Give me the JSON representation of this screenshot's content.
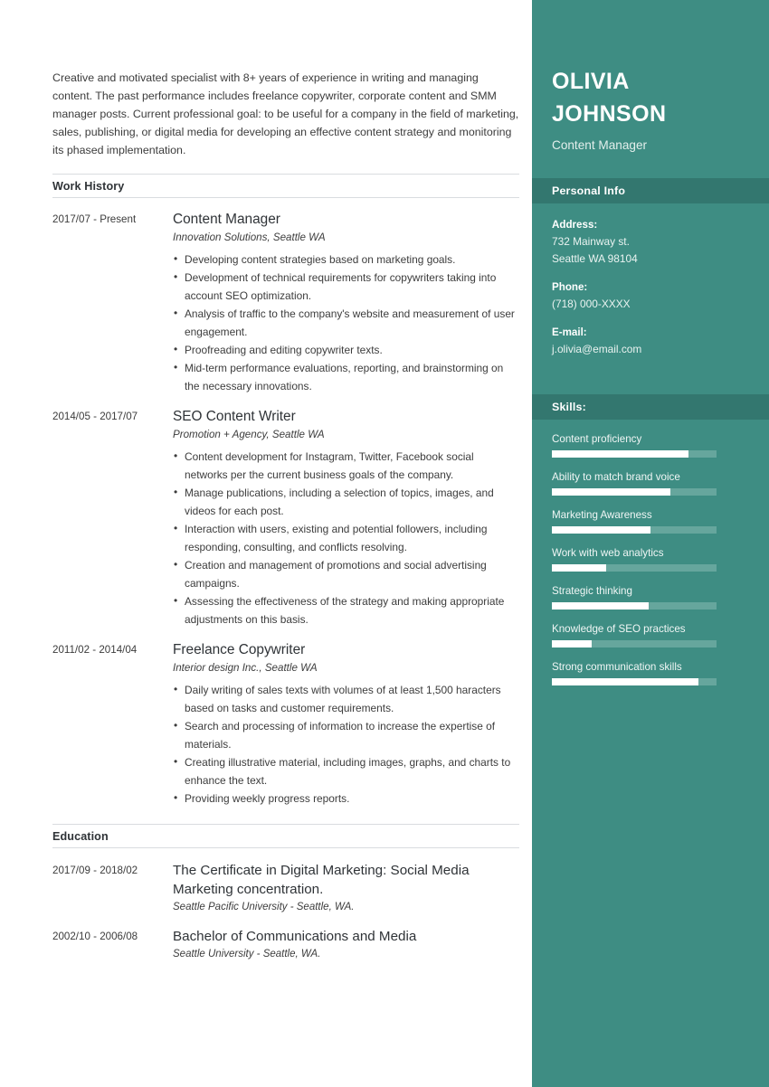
{
  "summary": "Creative and motivated specialist with 8+ years of experience in writing and managing content. The past performance includes freelance copywriter, corporate content and SMM manager posts. Current professional goal: to be useful for a company in the field of marketing, sales, publishing, or digital media for developing an effective content strategy and monitoring its phased implementation.",
  "sections": {
    "work_history_title": "Work History",
    "education_title": "Education"
  },
  "work_history": [
    {
      "date": "2017/07 - Present",
      "title": "Content Manager",
      "org": "Innovation Solutions, Seattle WA",
      "bullets": [
        "Developing content strategies based on marketing goals.",
        "Development of technical requirements for copywriters taking into account SEO optimization.",
        "Analysis of traffic to the company's website and measurement of user engagement.",
        "Proofreading and editing copywriter texts.",
        "Mid-term performance evaluations, reporting, and brainstorming on the necessary innovations."
      ]
    },
    {
      "date": "2014/05 - 2017/07",
      "title": "SEO Content Writer",
      "org": "Promotion + Agency, Seattle WA",
      "bullets": [
        "Content development for Instagram, Twitter, Facebook social networks per the current business goals of the company.",
        "Manage publications, including a selection of topics, images, and videos for each post.",
        "Interaction with users, existing and potential followers, including responding, consulting, and conflicts resolving.",
        "Creation and management of promotions and social advertising campaigns.",
        "Assessing the effectiveness of the strategy and making appropriate adjustments on this basis."
      ]
    },
    {
      "date": "2011/02 - 2014/04",
      "title": "Freelance Copywriter",
      "org": "Interior design Inc., Seattle WA",
      "bullets": [
        "Daily writing of sales texts with volumes of at least 1,500 haracters based on tasks and customer requirements.",
        "Search and processing of information to increase the expertise of materials.",
        "Creating illustrative material, including images, graphs, and charts to enhance the text.",
        "Providing weekly progress reports."
      ]
    }
  ],
  "education": [
    {
      "date": "2017/09 - 2018/02",
      "title": "The Certificate in Digital Marketing: Social Media Marketing concentration.",
      "org": "Seattle Pacific University - Seattle, WA."
    },
    {
      "date": "2002/10 - 2006/08",
      "title": "Bachelor of Communications and Media",
      "org": "Seattle University - Seattle, WA."
    }
  ],
  "sidebar": {
    "first_name": "OLIVIA",
    "last_name": "JOHNSON",
    "job_title": "Content Manager",
    "personal_info_title": "Personal Info",
    "skills_title": "Skills:",
    "info": [
      {
        "label": "Address:",
        "lines": [
          "732 Mainway st.",
          "Seattle WA 98104"
        ]
      },
      {
        "label": "Phone:",
        "lines": [
          "(718) 000-XXXX"
        ]
      },
      {
        "label": "E-mail:",
        "lines": [
          "j.olivia@email.com"
        ]
      }
    ],
    "skills": [
      {
        "label": "Content proficiency",
        "percent": 83
      },
      {
        "label": "Ability to match brand voice",
        "percent": 72
      },
      {
        "label": "Marketing Awareness",
        "percent": 60
      },
      {
        "label": "Work with web analytics",
        "percent": 33
      },
      {
        "label": "Strategic thinking",
        "percent": 59
      },
      {
        "label": "Knowledge of SEO practices",
        "percent": 24
      },
      {
        "label": "Strong communication skills",
        "percent": 89
      }
    ]
  },
  "colors": {
    "sidebar_teal": "#3e8d83",
    "sidebar_header_teal": "#33776f",
    "skill_track": "#66a69d",
    "skill_fill": "#ffffff",
    "body_text": "#3c3c3c",
    "rule": "#d9dcdf"
  }
}
